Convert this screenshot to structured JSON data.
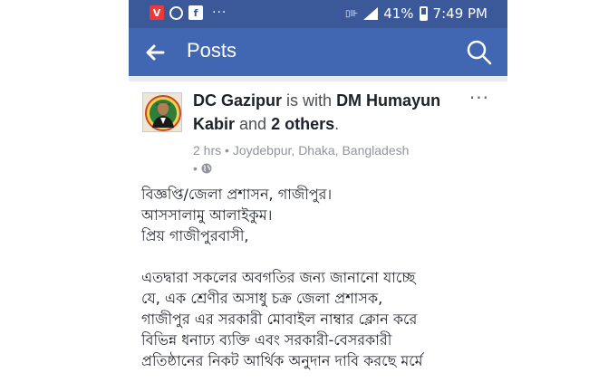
{
  "status_bar": {
    "dots": "···",
    "battery_percent": "41%",
    "time": "7:49 PM"
  },
  "app_bar": {
    "title": "Posts"
  },
  "post": {
    "author": "DC Gazipur",
    "is_with": "is with",
    "tagged": "DM Humayun Kabir",
    "and": "and",
    "others": "2 others",
    "period": ".",
    "time": "2 hrs",
    "separator": "•",
    "location": "Joydebpur, Dhaka, Bangladesh",
    "more": "···",
    "body_lines_1": [
      "বিজ্ঞপ্তি/জেলা প্রশাসন, গাজীপুর।",
      "আসসালামু আলাইকুম।",
      "প্রিয় গাজীপুরবাসী,"
    ],
    "body_lines_2": [
      "এতদ্বারা সকলের অবগতির জন্য জানানো যাচ্ছে",
      "যে, এক শ্রেণীর অসাধু চক্র জেলা প্রশাসক,",
      "গাজীপুর এর সরকারী মোবাইল নাম্বার ক্লোন করে",
      "বিভিন্ন ধনাঢ্য ব্যক্তি এবং সরকারী-বেসরকারী",
      "প্রতিষ্ঠানের নিকট আর্থিক অনুদান দাবি করছে মর্মে"
    ]
  },
  "colors": {
    "status_bar": "#3b5998",
    "app_bar": "#4267b2",
    "text": "#1d2129",
    "meta": "#90949c"
  }
}
